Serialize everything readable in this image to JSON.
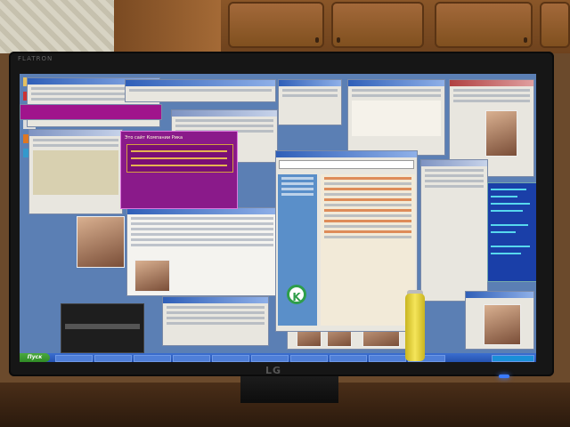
{
  "scene": {
    "description_tag": "photo-of-monitor",
    "monitor_brand": "LG",
    "top_brand": "FLATRON",
    "start_label": "Пуск",
    "purple_window_title": "Это сайт Компании Рика",
    "accent_colors": {
      "screen_bg": "#5b7fb4",
      "taskbar": "#2552b0",
      "purple_window": "#8a1a8a",
      "terminal": "#1a3fa8",
      "kaspersky_green": "#2e9e4a",
      "power_led": "#3a7bff"
    }
  }
}
